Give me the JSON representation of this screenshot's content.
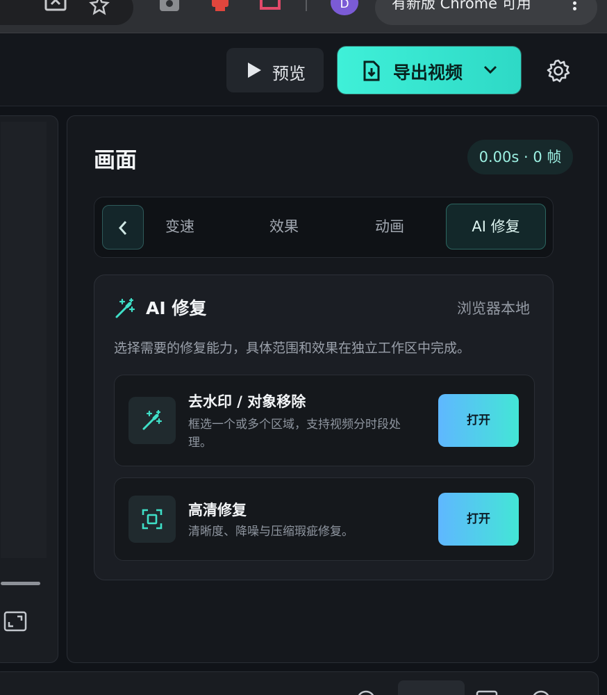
{
  "browser": {
    "profile_initial": "D",
    "update_label": "有新版 Chrome 可用",
    "icons": [
      "cast-icon",
      "bookmark-star-icon",
      "extension-camera-icon",
      "extension-robot-icon",
      "extension-puzzle-icon",
      "more-vert-icon"
    ]
  },
  "header": {
    "preview_label": "预览",
    "export_label": "导出视频"
  },
  "inspector": {
    "title": "画面",
    "time_badge": "0.00s · 0 帧",
    "tabs": [
      {
        "label": "变速",
        "active": false
      },
      {
        "label": "效果",
        "active": false
      },
      {
        "label": "动画",
        "active": false
      },
      {
        "label": "AI 修复",
        "active": true
      }
    ],
    "ai_card": {
      "title": "AI 修复",
      "meta": "浏览器本地",
      "description": "选择需要的修复能力，具体范围和效果在独立工作区中完成。",
      "features": [
        {
          "title": "去水印 / 对象移除",
          "description": "框选一个或多个区域，支持视频分时段处理。",
          "button": "打开",
          "icon": "magic-wand-icon"
        },
        {
          "title": "高清修复",
          "description": "清晰度、降噪与压缩瑕疵修复。",
          "button": "打开",
          "icon": "scan-frame-icon"
        }
      ]
    }
  },
  "colors": {
    "accent": "#3ff0d8",
    "open_gradient_start": "#5fb7ff",
    "open_gradient_end": "#43e6d6",
    "background": "#101318"
  }
}
